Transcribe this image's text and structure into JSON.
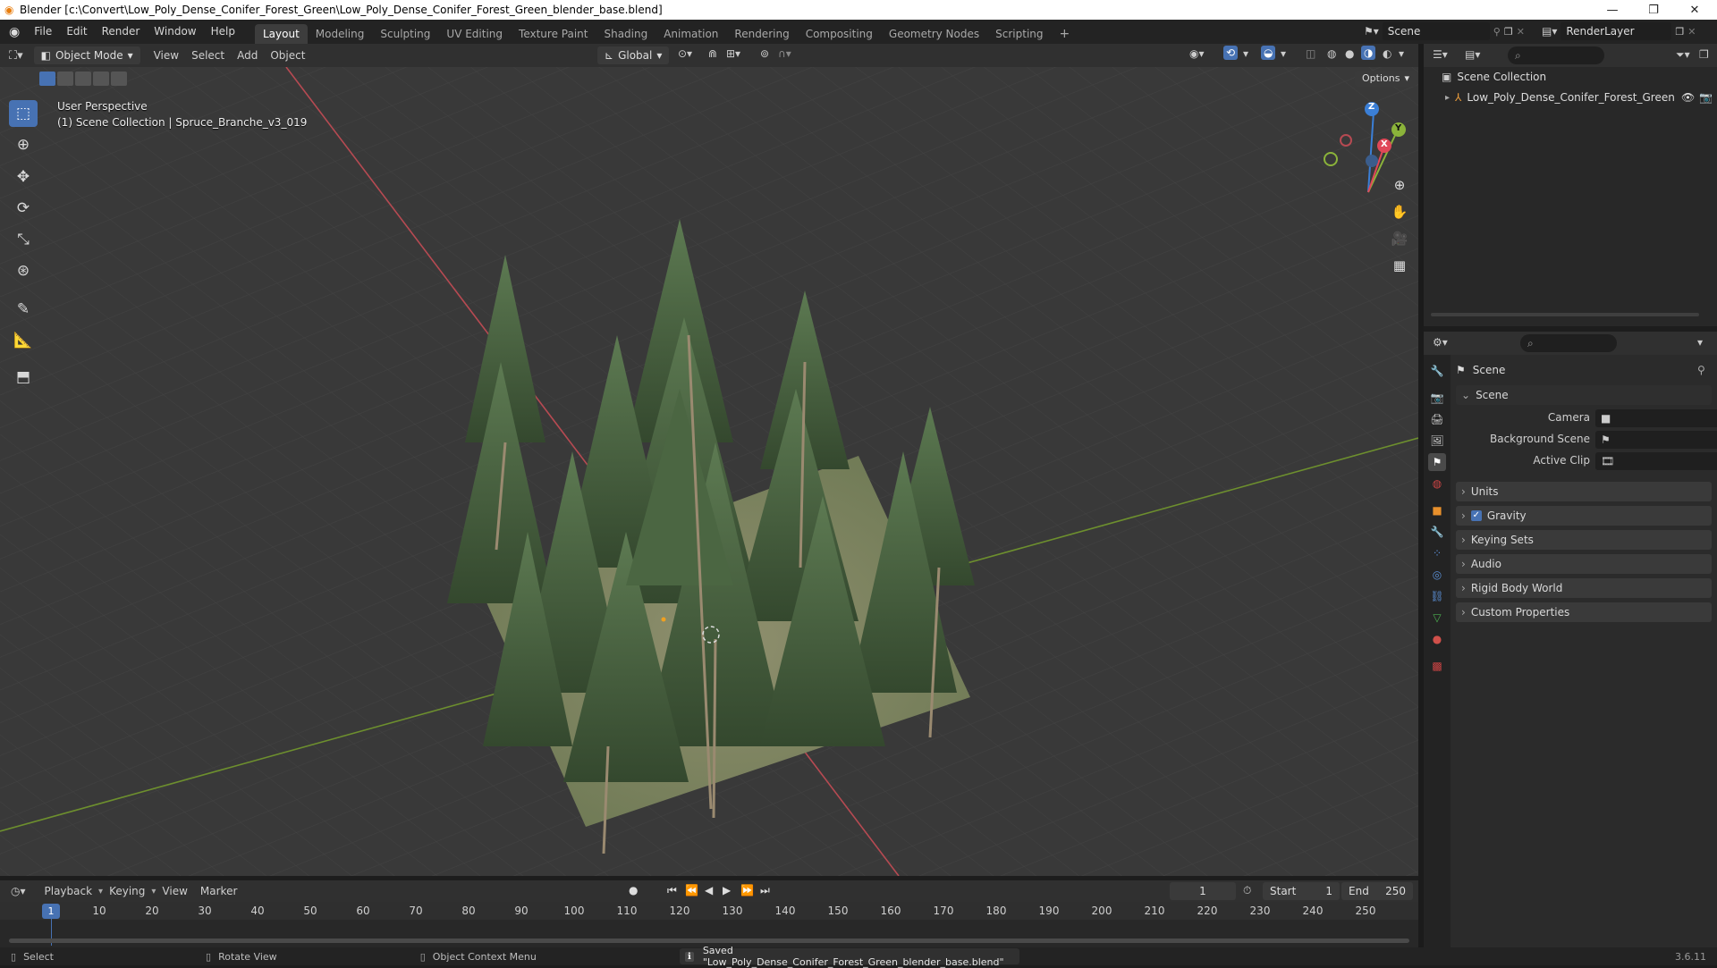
{
  "window": {
    "title": "Blender [c:\\Convert\\Low_Poly_Dense_Conifer_Forest_Green\\Low_Poly_Dense_Conifer_Forest_Green_blender_base.blend]",
    "minimize": "—",
    "maximize": "❐",
    "close": "✕"
  },
  "menubar": {
    "items": [
      "File",
      "Edit",
      "Render",
      "Window",
      "Help"
    ]
  },
  "workspaces": {
    "tabs": [
      "Layout",
      "Modeling",
      "Sculpting",
      "UV Editing",
      "Texture Paint",
      "Shading",
      "Animation",
      "Rendering",
      "Compositing",
      "Geometry Nodes",
      "Scripting"
    ],
    "active": "Layout",
    "add": "+"
  },
  "scene_selector": {
    "value": "Scene"
  },
  "view_layer_selector": {
    "value": "RenderLayer"
  },
  "viewport_header": {
    "mode": "Object Mode",
    "menus": [
      "View",
      "Select",
      "Add",
      "Object"
    ],
    "transform_orientation": "Global",
    "options_label": "Options"
  },
  "viewport": {
    "perspective_label": "User Perspective",
    "context_label": "(1) Scene Collection | Spruce_Branche_v3_019",
    "gizmo_axes": {
      "x": "X",
      "y": "Y",
      "z": "Z"
    },
    "colors": {
      "x_axis": "#e04858",
      "y_axis": "#8bb33a",
      "z_axis": "#3b7fd6",
      "background": "#393939",
      "grid": "#444444"
    }
  },
  "outliner": {
    "root": "Scene Collection",
    "items": [
      {
        "label": "Low_Poly_Dense_Conifer_Forest_Green"
      }
    ]
  },
  "properties": {
    "context_title": "Scene",
    "panel_title": "Scene",
    "fields": [
      {
        "label": "Camera",
        "value": ""
      },
      {
        "label": "Background Scene",
        "value": ""
      },
      {
        "label": "Active Clip",
        "value": ""
      }
    ],
    "subpanels": [
      "Units",
      "Gravity",
      "Keying Sets",
      "Audio",
      "Rigid Body World",
      "Custom Properties"
    ],
    "gravity_checked": true
  },
  "timeline": {
    "menus": [
      "Playback",
      "Keying",
      "View",
      "Marker"
    ],
    "current_frame": "1",
    "start_label": "Start",
    "start": "1",
    "end_label": "End",
    "end": "250",
    "frame_numbers": [
      "1",
      "10",
      "20",
      "30",
      "40",
      "50",
      "60",
      "70",
      "80",
      "90",
      "100",
      "110",
      "120",
      "130",
      "140",
      "150",
      "160",
      "170",
      "180",
      "190",
      "200",
      "210",
      "220",
      "230",
      "240",
      "250"
    ]
  },
  "statusbar": {
    "select": "Select",
    "rotate": "Rotate View",
    "context_menu": "Object Context Menu",
    "message": "Saved \"Low_Poly_Dense_Conifer_Forest_Green_blender_base.blend\"",
    "version": "3.6.11"
  }
}
